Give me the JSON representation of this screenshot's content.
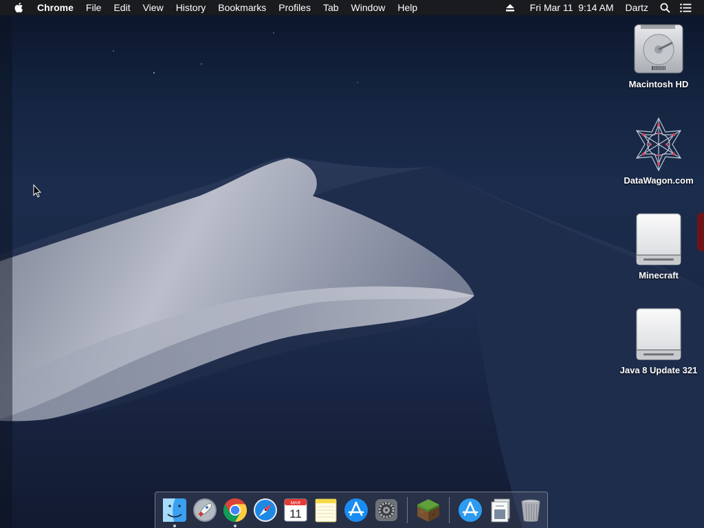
{
  "menubar": {
    "apple_icon": "apple-logo-icon",
    "app_name": "Chrome",
    "menus": [
      "File",
      "Edit",
      "View",
      "History",
      "Bookmarks",
      "Profiles",
      "Tab",
      "Window",
      "Help"
    ],
    "status": {
      "eject_icon": "eject-icon",
      "datetime": "Fri Mar 11  9:14 AM",
      "user": "Dartz",
      "search_icon": "spotlight-search-icon",
      "notification_icon": "notification-center-icon"
    }
  },
  "desktop_icons": [
    {
      "label": "Macintosh HD",
      "icon": "hard-drive-icon"
    },
    {
      "label": "DataWagon.com",
      "icon": "datawagon-logo-icon"
    },
    {
      "label": "Minecraft",
      "icon": "external-disk-icon"
    },
    {
      "label": "Java 8 Update 321",
      "icon": "external-disk-icon"
    }
  ],
  "dock": {
    "items": [
      {
        "name": "Finder",
        "icon": "finder-icon",
        "running": true
      },
      {
        "name": "Launchpad",
        "icon": "launchpad-icon",
        "running": false
      },
      {
        "name": "Google Chrome",
        "icon": "chrome-icon",
        "running": true
      },
      {
        "name": "Safari",
        "icon": "safari-icon",
        "running": false
      },
      {
        "name": "Calendar",
        "icon": "calendar-icon",
        "running": false,
        "month": "MAR",
        "day": "11"
      },
      {
        "name": "Notes",
        "icon": "notes-icon",
        "running": false
      },
      {
        "name": "App Store",
        "icon": "app-store-icon",
        "running": false
      },
      {
        "name": "System Preferences",
        "icon": "system-preferences-icon",
        "running": false
      },
      {
        "name": "Minecraft",
        "icon": "minecraft-icon",
        "running": false
      },
      {
        "name": "Applications",
        "icon": "applications-folder-icon",
        "running": false
      },
      {
        "name": "Documents",
        "icon": "documents-stack-icon",
        "running": false
      },
      {
        "name": "Trash",
        "icon": "trash-icon",
        "running": false
      }
    ]
  },
  "colors": {
    "menubar_bg": "#1c1c1e",
    "wallpaper_sky": "#1b2c4c",
    "dune_light": "#c9ccd6",
    "edge_tab": "#6e1418"
  }
}
